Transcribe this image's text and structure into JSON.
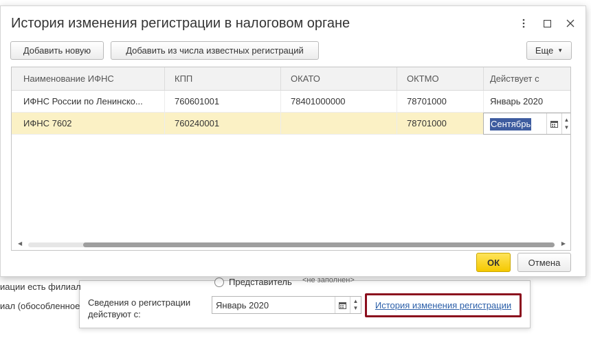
{
  "background": {
    "left_text_1": "иации есть филиал",
    "left_text_2": "иал (обособленное",
    "radio_label": "Представитель",
    "not_filled": "<не заполнен>",
    "info_label_1": "Сведения о регистрации",
    "info_label_2": "действуют с:",
    "date_value": "Январь 2020",
    "history_link": "История изменения регистрации"
  },
  "dialog": {
    "title": "История изменения регистрации в налоговом органе",
    "toolbar": {
      "add_new": "Добавить новую",
      "add_known": "Добавить из числа известных регистраций",
      "more": "Еще"
    },
    "columns": [
      "Наименование ИФНС",
      "КПП",
      "ОКАТО",
      "ОКТМО",
      "Действует с"
    ],
    "rows": [
      [
        "ИФНС России по Ленинско...",
        "760601001",
        "78401000000",
        "78701000",
        "Январь 2020"
      ],
      [
        "ИФНС 7602",
        "760240001",
        "",
        "78701000",
        "Сентябрь"
      ]
    ],
    "editing_value": "Сентябрь",
    "ok": "ОК",
    "cancel": "Отмена"
  },
  "colors": {
    "ok_button": "#f4c800",
    "selected_row": "#fbf1c5",
    "highlight_box": "#8b0d1d",
    "link": "#2a5ea8",
    "selection": "#3e5c9f"
  },
  "icons": [
    "more-vertical-icon",
    "maximize-icon",
    "close-icon",
    "dropdown-arrow-icon",
    "calendar-icon",
    "spin-up-icon",
    "spin-down-icon",
    "scroll-left-icon",
    "scroll-right-icon"
  ]
}
